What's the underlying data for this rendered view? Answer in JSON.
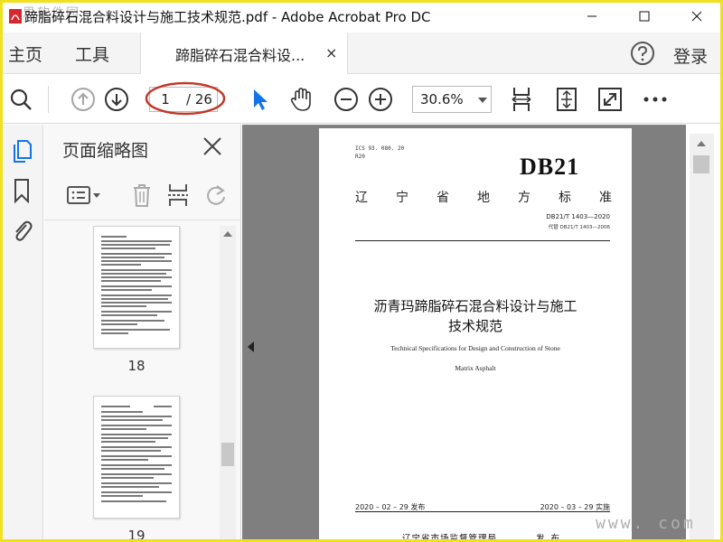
{
  "window": {
    "title": "蹄脂碎石混合料设计与施工技术规范.pdf - Adobe Acrobat Pro DC",
    "watermark_top_left": "思软件园",
    "colors": {
      "frame": "#f0e020",
      "accent_blue": "#1473e6",
      "annotation_red": "#c0392b"
    }
  },
  "tabs": {
    "home": "主页",
    "tools": "工具",
    "document": "蹄脂碎石混合料设...",
    "close_symbol": "×",
    "login": "登录"
  },
  "toolbar": {
    "page_current": "1",
    "page_total": "/ 26",
    "zoom": "30.6%",
    "icons": [
      "search-icon",
      "prev-page-icon",
      "next-page-icon",
      "select-cursor-icon",
      "hand-icon",
      "zoom-out-icon",
      "zoom-in-icon",
      "fit-page-icon",
      "scroll-mode-icon",
      "full-screen-icon",
      "more-icon"
    ]
  },
  "sidebar": {
    "panel_title": "页面缩略图",
    "thumbnails": [
      {
        "label": "18"
      },
      {
        "label": "19"
      }
    ]
  },
  "document_page": {
    "ics": "ICS  93. 080. 20",
    "ccs": "R20",
    "db_code": "DB21",
    "standard_type_chars": [
      "辽",
      "宁",
      "省",
      "地",
      "方",
      "标",
      "准"
    ],
    "standard_number": "DB21/T  1403—2020",
    "replaces": "代替 DB21/T  1403—2006",
    "title_cn_line1": "沥青玛蹄脂碎石混合料设计与施工",
    "title_cn_line2": "技术规范",
    "title_en_line1": "Technical Specifications for Design and Construction of    Stone",
    "title_en_line2": "Matrix Asphalt",
    "issue_date": "2020 – 02 – 29 发布",
    "implement_date": "2020 – 03 – 29 实施",
    "issuer": "辽宁省市场监督管理局",
    "publish_word": "发 布"
  },
  "watermark_bottom_right": "www.      com"
}
